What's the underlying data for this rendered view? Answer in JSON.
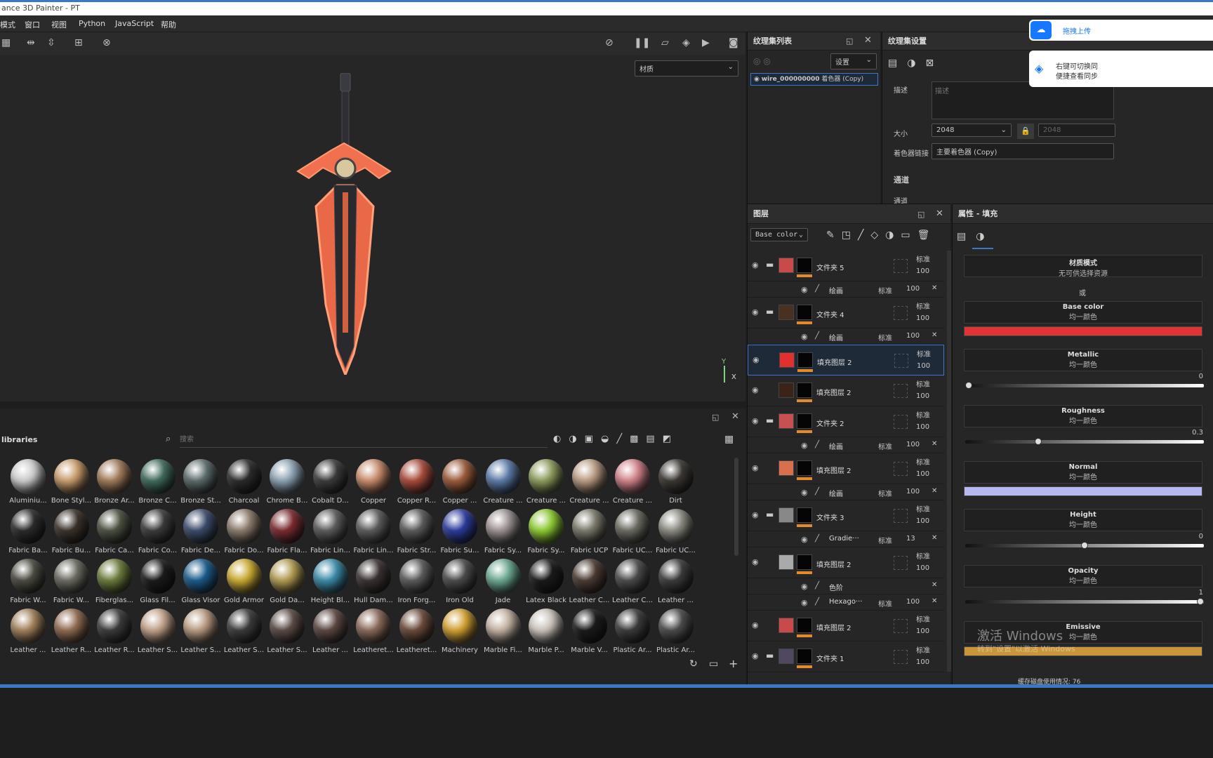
{
  "app": {
    "title": "ance 3D Painter - PT"
  },
  "menu": [
    "模式",
    "窗口",
    "视图",
    "Python",
    "JavaScript",
    "帮助"
  ],
  "viewport": {
    "material_select": "材质",
    "axis_y": "Y",
    "axis_x": "X"
  },
  "texlist": {
    "title": "纹理集列表",
    "settings_select": "设置",
    "item": "wire_000000000",
    "item_sub": "着色器 (Copy)"
  },
  "texset": {
    "title": "纹理集设置",
    "desc_label": "描述",
    "desc_placeholder": "描述",
    "size_label": "大小",
    "size_value": "2048",
    "size_value2": "2048",
    "shader_label": "着色器链接",
    "shader_value": "主要着色器 (Copy)",
    "channels": "通道",
    "channels2": "通道"
  },
  "upload": {
    "button": "拖拽上传",
    "tip1": "右键可切换同",
    "tip2": "便捷查看同步"
  },
  "layers": {
    "title": "图层",
    "channel_select": "Base color",
    "rows": [
      {
        "name": "文件夹 5",
        "blend": "标准",
        "opacity": "100",
        "color": "#c84a4a",
        "type": "folder"
      },
      {
        "name": "绘画",
        "blend": "标准",
        "opacity": "100",
        "sub": true
      },
      {
        "name": "文件夹 4",
        "blend": "标准",
        "opacity": "100",
        "color": "#4a3020",
        "type": "folder"
      },
      {
        "name": "绘画",
        "blend": "标准",
        "opacity": "100",
        "sub": true
      },
      {
        "name": "填充图层 2",
        "blend": "标准",
        "opacity": "100",
        "color": "#e03030",
        "type": "fill",
        "selected": true
      },
      {
        "name": "填充图层 2",
        "blend": "标准",
        "opacity": "100",
        "color": "#3a2418",
        "type": "fill"
      },
      {
        "name": "文件夹 2",
        "blend": "标准",
        "opacity": "100",
        "color": "#c85050",
        "type": "folder"
      },
      {
        "name": "绘画",
        "blend": "标准",
        "opacity": "100",
        "sub": true
      },
      {
        "name": "填充图层 2",
        "blend": "标准",
        "opacity": "100",
        "color": "#d87050",
        "type": "fill"
      },
      {
        "name": "绘画",
        "blend": "标准",
        "opacity": "100",
        "sub": true
      },
      {
        "name": "文件夹 3",
        "blend": "标准",
        "opacity": "100",
        "color": "#888",
        "type": "folder"
      },
      {
        "name": "Gradie···",
        "blend": "标准",
        "opacity": "13",
        "sub": true
      },
      {
        "name": "填充图层 2",
        "blend": "标准",
        "opacity": "100",
        "color": "#aaa",
        "type": "fill"
      },
      {
        "name": "色阶",
        "blend": "",
        "opacity": "",
        "sub": true
      },
      {
        "name": "Hexago···",
        "blend": "标准",
        "opacity": "100",
        "sub": true
      },
      {
        "name": "填充图层 2",
        "blend": "标准",
        "opacity": "100",
        "color": "#c84a4a",
        "type": "fill"
      },
      {
        "name": "文件夹 1",
        "blend": "标准",
        "opacity": "100",
        "color": "#504860",
        "type": "folder"
      }
    ]
  },
  "props": {
    "title": "属性 - 填充",
    "material_mode": "材质模式",
    "material_mode_sub": "无可供选择资源",
    "or": "或",
    "channels": [
      {
        "name": "Base color",
        "sub": "均一颜色",
        "color": "#e03535"
      },
      {
        "name": "Metallic",
        "sub": "均一颜色",
        "value": "0",
        "slider": 0.0
      },
      {
        "name": "Roughness",
        "sub": "均一颜色",
        "value": "0.3",
        "slider": 0.3
      },
      {
        "name": "Normal",
        "sub": "均一颜色",
        "color": "#b8b8f0"
      },
      {
        "name": "Height",
        "sub": "均一颜色",
        "value": "0",
        "slider": 0.5
      },
      {
        "name": "Opacity",
        "sub": "均一颜色",
        "value": "1",
        "slider": 1.0
      },
      {
        "name": "Emissive",
        "sub": "均一颜色",
        "color": "#c8953a"
      }
    ]
  },
  "shelf": {
    "title": "libraries",
    "search_placeholder": "搜索",
    "rows": [
      [
        "Aluminiu...",
        "Bone Styl...",
        "Bronze Ar...",
        "Bronze C...",
        "Bronze St...",
        "Charcoal",
        "Chrome B...",
        "Cobalt D...",
        "Copper",
        "Copper R...",
        "Copper ...",
        "Creature ...",
        "Creature ...",
        "Creature ...",
        "Creature ...",
        "Dirt"
      ],
      [
        "Fabric Ba...",
        "Fabric Bu...",
        "Fabric Ca...",
        "Fabric Co...",
        "Fabric De...",
        "Fabric Do...",
        "Fabric Fla...",
        "Fabric Lin...",
        "Fabric Lin...",
        "Fabric Str...",
        "Fabric Su...",
        "Fabric Sy...",
        "Fabric Sy...",
        "Fabric UCP",
        "Fabric UC...",
        "Fabric UC..."
      ],
      [
        "Fabric W...",
        "Fabric W...",
        "Fiberglas...",
        "Glass Fil...",
        "Glass Visor",
        "Gold Armor",
        "Gold Da...",
        "Height Bl...",
        "Hull Dam...",
        "Iron Forg...",
        "Iron Old",
        "Jade",
        "Latex Black",
        "Leather C...",
        "Leather C...",
        "Leather ..."
      ],
      [
        "Leather ...",
        "Leather R...",
        "Leather R...",
        "Leather S...",
        "Leather S...",
        "Leather S...",
        "Leather S...",
        "Leather ...",
        "Leatheret...",
        "Leatheret...",
        "Machinery",
        "Marble Fi...",
        "Marble P...",
        "Marble V...",
        "Plastic Ar...",
        "Plastic Ar..."
      ]
    ],
    "colors": [
      [
        "#c8c8c8",
        "#c89a6a",
        "#a07a5a",
        "#3e6a5a",
        "#5a6a6a",
        "#2a2a2a",
        "#8aa0b0",
        "#3a3a3a",
        "#c88a6a",
        "#a84a3a",
        "#9a5a3a",
        "#5a7aa8",
        "#8a9a5a",
        "#b89a80",
        "#d08088",
        "#3a3632"
      ],
      [
        "#2a2a2a",
        "#3a3028",
        "#4a5040",
        "#3a3a3a",
        "#3a4a6a",
        "#8a7a6a",
        "#7a2a30",
        "#5a5a5a",
        "#5a5a5a",
        "#5a5a5a",
        "#2a3a9a",
        "#9a9090",
        "#8ac830",
        "#7a7868",
        "#6a6a60",
        "#8a8a80"
      ],
      [
        "#4a4a40",
        "#6a6a60",
        "#6a7a3a",
        "#1a1a1a",
        "#1a5a8a",
        "#c8a830",
        "#b09a50",
        "#3a8aa8",
        "#3a3030",
        "#5a5a5a",
        "#4a4a4a",
        "#6aa890",
        "#1a1a1a",
        "#4a3a30",
        "#4a4a4a",
        "#3a3a3a"
      ],
      [
        "#a0805a",
        "#906a50",
        "#3a3a3a",
        "#c0a088",
        "#b89a80",
        "#3a3a3a",
        "#5a4a44",
        "#5a4640",
        "#8a6a5a",
        "#6a4a3a",
        "#d0a030",
        "#c0b0a0",
        "#c8c0b8",
        "#1a1a1a",
        "#3a3a3a",
        "#4a4a4a"
      ]
    ]
  },
  "status": {
    "disk": "缓存磁盘使用情况: 76"
  },
  "watermark": {
    "line1": "激活 Windows",
    "line2": "转到\"设置\"以激活 Windows"
  }
}
